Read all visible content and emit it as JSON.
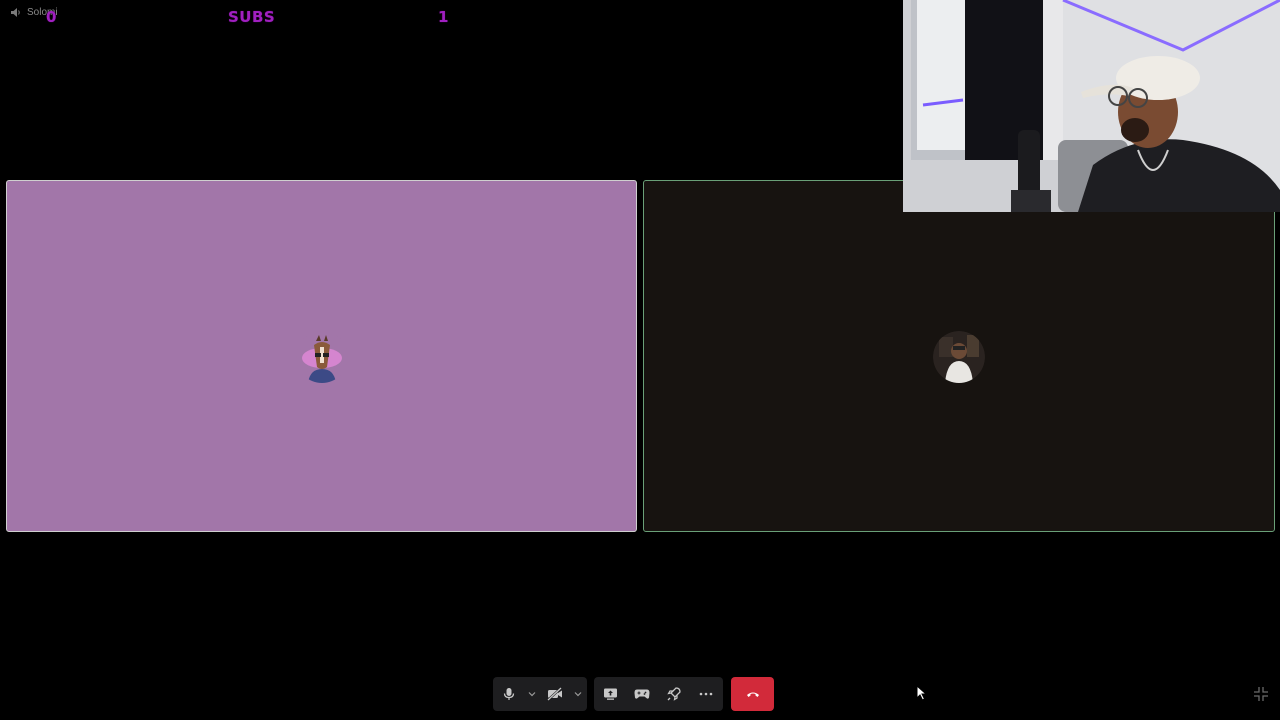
{
  "header": {
    "channel_name": "Solomi"
  },
  "overlay": {
    "count_left": "0",
    "subs_label": "SUBS",
    "count_right": "1"
  },
  "tiles": [
    {
      "name": "participant-left",
      "background": "#a276a9",
      "avatar": "horse-avatar"
    },
    {
      "name": "participant-right",
      "background": "#171310",
      "avatar": "person-avatar"
    }
  ],
  "toolbar": {
    "buttons": [
      {
        "icon": "microphone-icon"
      },
      {
        "icon": "chevron-down-icon"
      },
      {
        "icon": "camera-off-icon"
      },
      {
        "icon": "chevron-down-icon"
      },
      {
        "icon": "screen-share-icon"
      },
      {
        "icon": "gamepad-icon"
      },
      {
        "icon": "rocket-icon"
      },
      {
        "icon": "more-icon"
      },
      {
        "icon": "hang-up-icon"
      },
      {
        "icon": "exit-fullscreen-icon"
      }
    ],
    "hangup_color": "#d22a3a"
  }
}
